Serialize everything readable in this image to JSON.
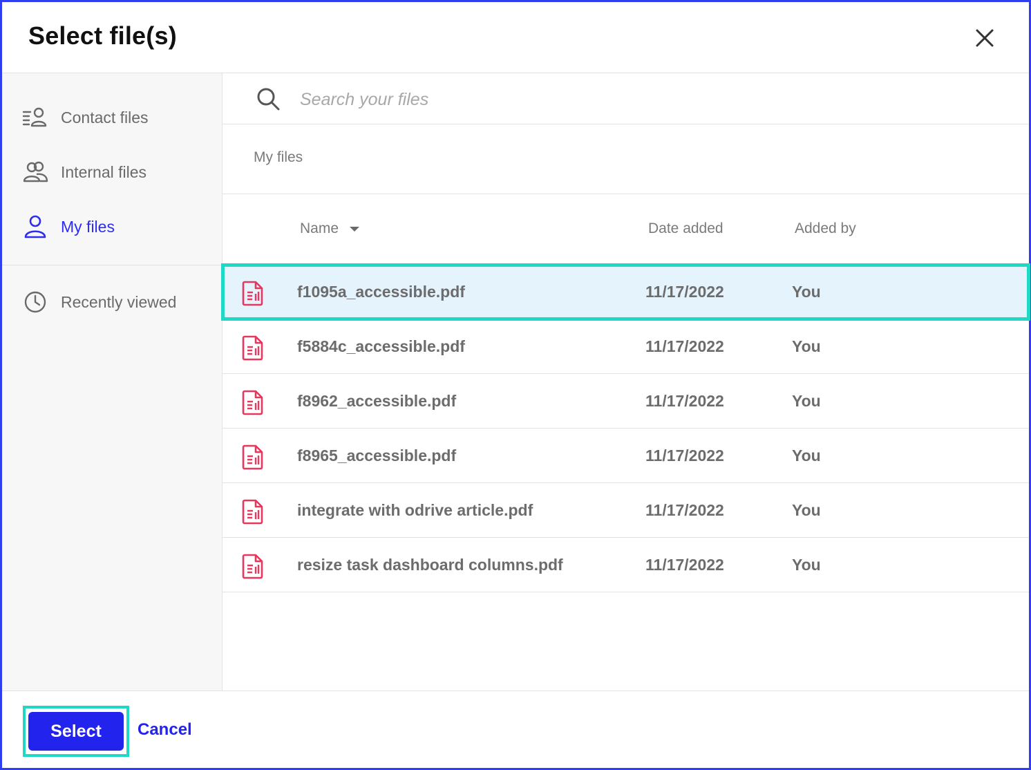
{
  "dialog": {
    "title": "Select file(s)",
    "close_icon": "close-icon"
  },
  "sidebar": {
    "items": [
      {
        "label": "Contact files",
        "icon": "contact-files-icon",
        "active": false
      },
      {
        "label": "Internal files",
        "icon": "users-icon",
        "active": false
      },
      {
        "label": "My files",
        "icon": "user-icon",
        "active": true
      },
      {
        "label": "Recently viewed",
        "icon": "clock-icon",
        "active": false
      }
    ]
  },
  "search": {
    "placeholder": "Search your files",
    "value": ""
  },
  "breadcrumb": "My files",
  "table": {
    "columns": {
      "name": "Name",
      "date": "Date added",
      "by": "Added by"
    },
    "sort": {
      "column": "name",
      "icon": "sort-down-icon"
    },
    "rows": [
      {
        "name": "f1095a_accessible.pdf",
        "date": "11/17/2022",
        "by": "You",
        "selected": true
      },
      {
        "name": "f5884c_accessible.pdf",
        "date": "11/17/2022",
        "by": "You",
        "selected": false
      },
      {
        "name": "f8962_accessible.pdf",
        "date": "11/17/2022",
        "by": "You",
        "selected": false
      },
      {
        "name": "f8965_accessible.pdf",
        "date": "11/17/2022",
        "by": "You",
        "selected": false
      },
      {
        "name": "integrate with odrive article.pdf",
        "date": "11/17/2022",
        "by": "You",
        "selected": false
      },
      {
        "name": "resize task dashboard columns.pdf",
        "date": "11/17/2022",
        "by": "You",
        "selected": false
      }
    ],
    "file_icon": "pdf-file-icon"
  },
  "footer": {
    "select_label": "Select",
    "cancel_label": "Cancel"
  },
  "colors": {
    "accent": "#2323ee",
    "border": "#2f3ef0",
    "highlight_outline": "#1fd9c6",
    "selected_row_bg": "#e5f3fd",
    "pdf_icon": "#e8365d"
  }
}
